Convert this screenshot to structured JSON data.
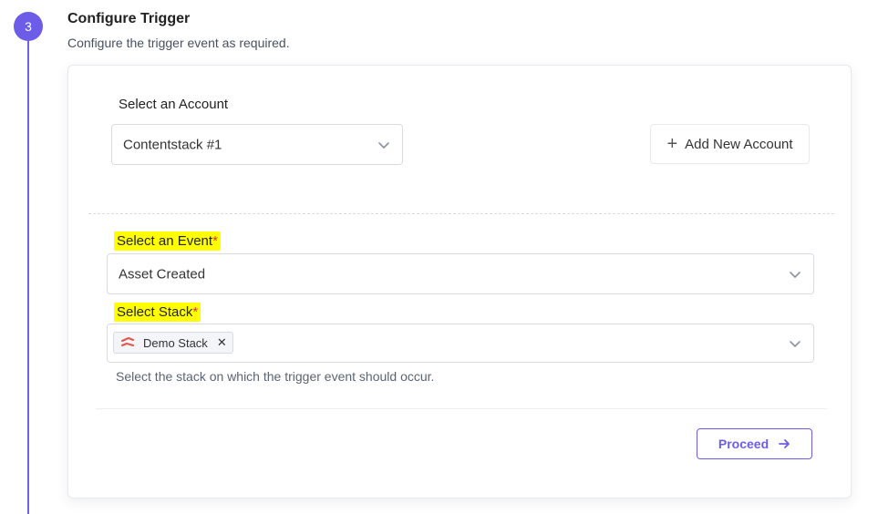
{
  "step": {
    "number": "3",
    "title": "Configure Trigger",
    "description": "Configure the trigger event as required."
  },
  "account": {
    "label": "Select an Account",
    "selected": "Contentstack #1",
    "add_button_label": "Add New Account"
  },
  "event": {
    "label": "Select an Event",
    "required_mark": "*",
    "selected": "Asset Created"
  },
  "stack": {
    "label": "Select Stack",
    "required_mark": "*",
    "selected_tags": [
      "Demo Stack"
    ],
    "help_text": "Select the stack on which the trigger event should occur."
  },
  "actions": {
    "proceed_label": "Proceed"
  },
  "colors": {
    "accent": "#6c5ce7",
    "highlight": "#ffff00",
    "required": "#d63a3a"
  },
  "icons": [
    "chevron-down-icon",
    "plus-icon",
    "contentstack-logo-icon",
    "close-icon",
    "arrow-right-icon"
  ]
}
